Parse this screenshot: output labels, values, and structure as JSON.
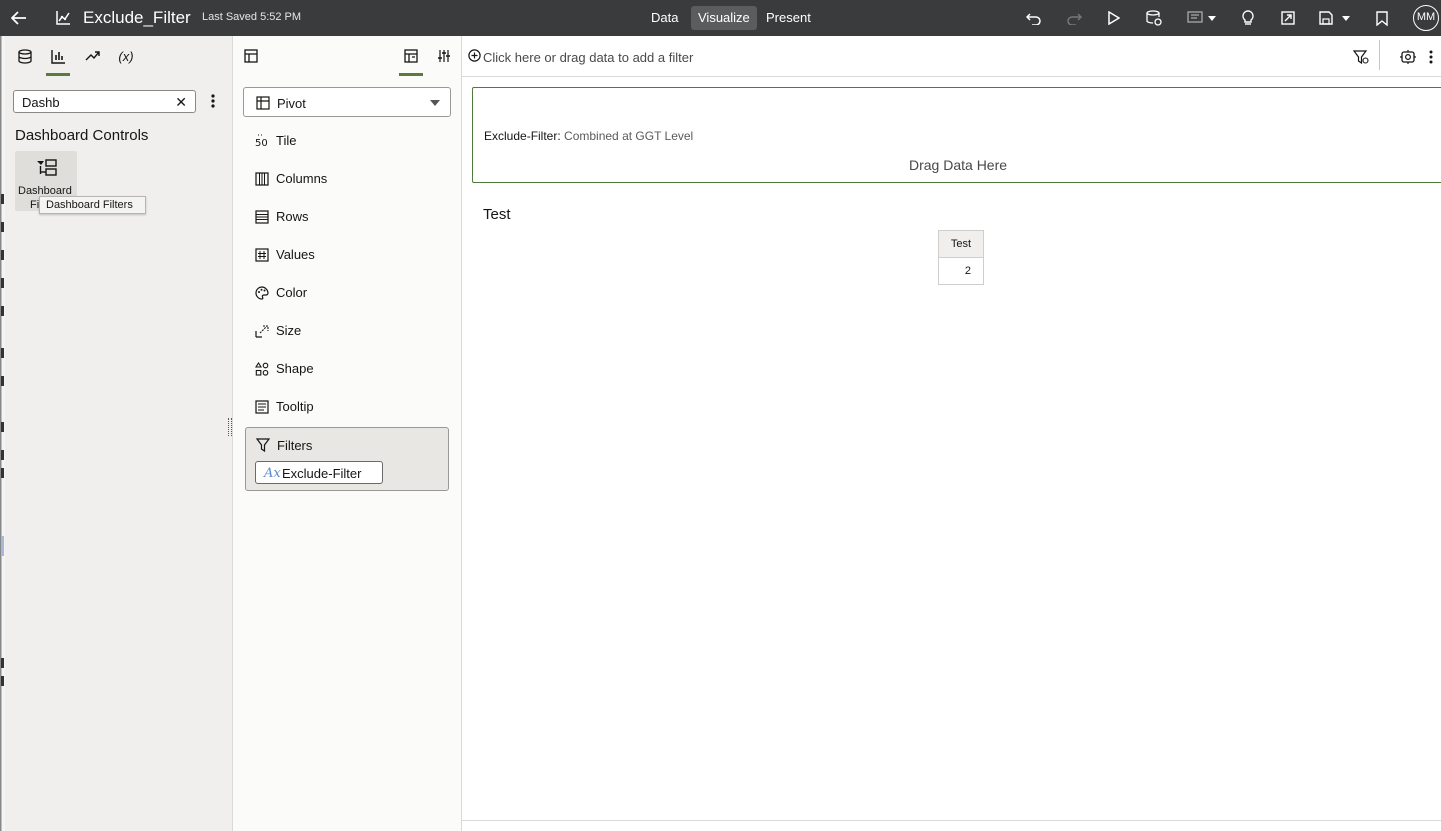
{
  "topbar": {
    "title": "Exclude_Filter",
    "saved": "Last Saved 5:52 PM",
    "nav": [
      "Data",
      "Visualize",
      "Present"
    ],
    "active_nav": "Visualize",
    "avatar": "MM"
  },
  "left_panel": {
    "search_value": "Dashb",
    "section_title": "Dashboard Controls",
    "tile_label_line1": "Dashboard",
    "tile_label_line2": "Fi",
    "tooltip": "Dashboard Filters",
    "formula_tab_label": "(x)"
  },
  "grammar": {
    "viz_type": "Pivot",
    "items": [
      "Tile",
      "Columns",
      "Rows",
      "Values",
      "Color",
      "Size",
      "Shape",
      "Tooltip"
    ],
    "filters_label": "Filters",
    "filter_pill": "Exclude-Filter"
  },
  "canvas": {
    "filter_hint": "Click here or drag data to add a filter",
    "filter_key": "Exclude-Filter:",
    "filter_value": "Combined at GGT Level",
    "drag_hint": "Drag Data Here",
    "viz_title": "Test",
    "table": {
      "header": "Test",
      "value": "2"
    }
  },
  "colors": {
    "topbar": "#3a3b3d",
    "accent": "#5a7b3b",
    "panel": "#f1efed"
  }
}
